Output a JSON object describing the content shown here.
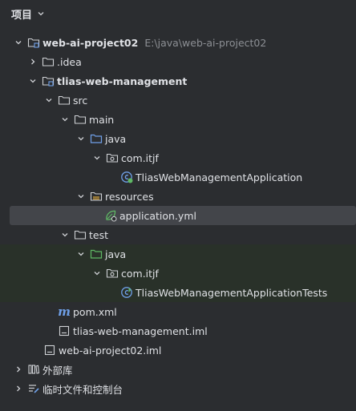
{
  "panel": {
    "title": "项目"
  },
  "tree": [
    {
      "label": "web-ai-project02",
      "path": "E:\\java\\web-ai-project02"
    },
    {
      "label": ".idea"
    },
    {
      "label": "tlias-web-management"
    },
    {
      "label": "src"
    },
    {
      "label": "main"
    },
    {
      "label": "java"
    },
    {
      "label": "com.itjf"
    },
    {
      "label": "TliasWebManagementApplication"
    },
    {
      "label": "resources"
    },
    {
      "label": "application.yml"
    },
    {
      "label": "test"
    },
    {
      "label": "java"
    },
    {
      "label": "com.itjf"
    },
    {
      "label": "TliasWebManagementApplicationTests"
    },
    {
      "label": "pom.xml"
    },
    {
      "label": "tlias-web-management.iml"
    },
    {
      "label": "web-ai-project02.iml"
    },
    {
      "label": "外部库"
    },
    {
      "label": "临时文件和控制台"
    }
  ],
  "colors": {
    "background": "#2b2d30",
    "selection": "#43454a",
    "test_highlight": "#293129",
    "source_folder": "#6fa0e8",
    "test_folder": "#5fb865"
  }
}
